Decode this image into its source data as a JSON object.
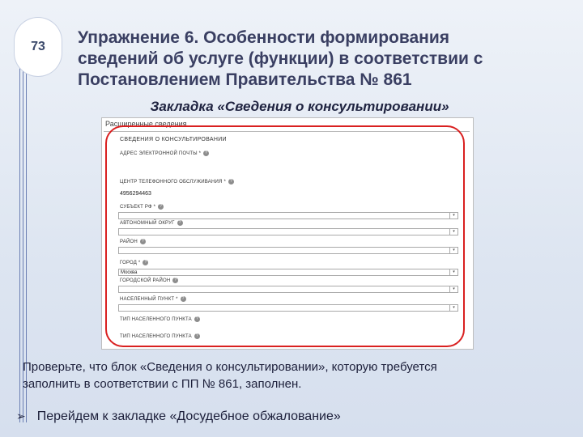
{
  "slide": {
    "number": "73",
    "title_line1": "Упражнение 6. Особенности формирования",
    "title_line2": "сведений об услуге (функции) в соответствии с",
    "title_line3": "Постановлением Правительства № 861",
    "subtitle": "Закладка «Сведения о консультировании»",
    "body_line1": "Проверьте, что блок «Сведения о консультировании», которую требуется",
    "body_line2": "заполнить в соответствии с ПП № 861, заполнен.",
    "bullet": "Перейдем к закладке «Досудебное обжалование»"
  },
  "form": {
    "header": "Расширенные сведения",
    "section": "СВЕДЕНИЯ О КОНСУЛЬТИРОВАНИИ",
    "fields": [
      {
        "label": "АДРЕС ЭЛЕКТРОННОЙ ПОЧТЫ *",
        "value": ""
      },
      {
        "label": "ЦЕНТР ТЕЛЕФОННОГО ОБСЛУЖИВАНИЯ *",
        "value": "4956294463"
      },
      {
        "label": "СУБЪЕКТ РФ *",
        "value": ""
      },
      {
        "label": "АВТОНОМНЫЙ ОКРУГ",
        "value": ""
      },
      {
        "label": "РАЙОН",
        "value": ""
      },
      {
        "label": "ГОРОД *",
        "value": "Москва"
      },
      {
        "label": "ГОРОДСКОЙ РАЙОН",
        "value": ""
      },
      {
        "label": "НАСЕЛЕННЫЙ ПУНКТ *",
        "value": ""
      },
      {
        "label": "ТИП НАСЕЛЕННОГО ПУНКТА",
        "value": ""
      },
      {
        "label": "ТИП НАСЕЛЕННОГО ПУНКТА",
        "value": ""
      }
    ],
    "help_glyph": "?",
    "dropdown_glyph": "▾"
  },
  "colors": {
    "highlight": "#d92020",
    "title": "#3a3f62"
  }
}
